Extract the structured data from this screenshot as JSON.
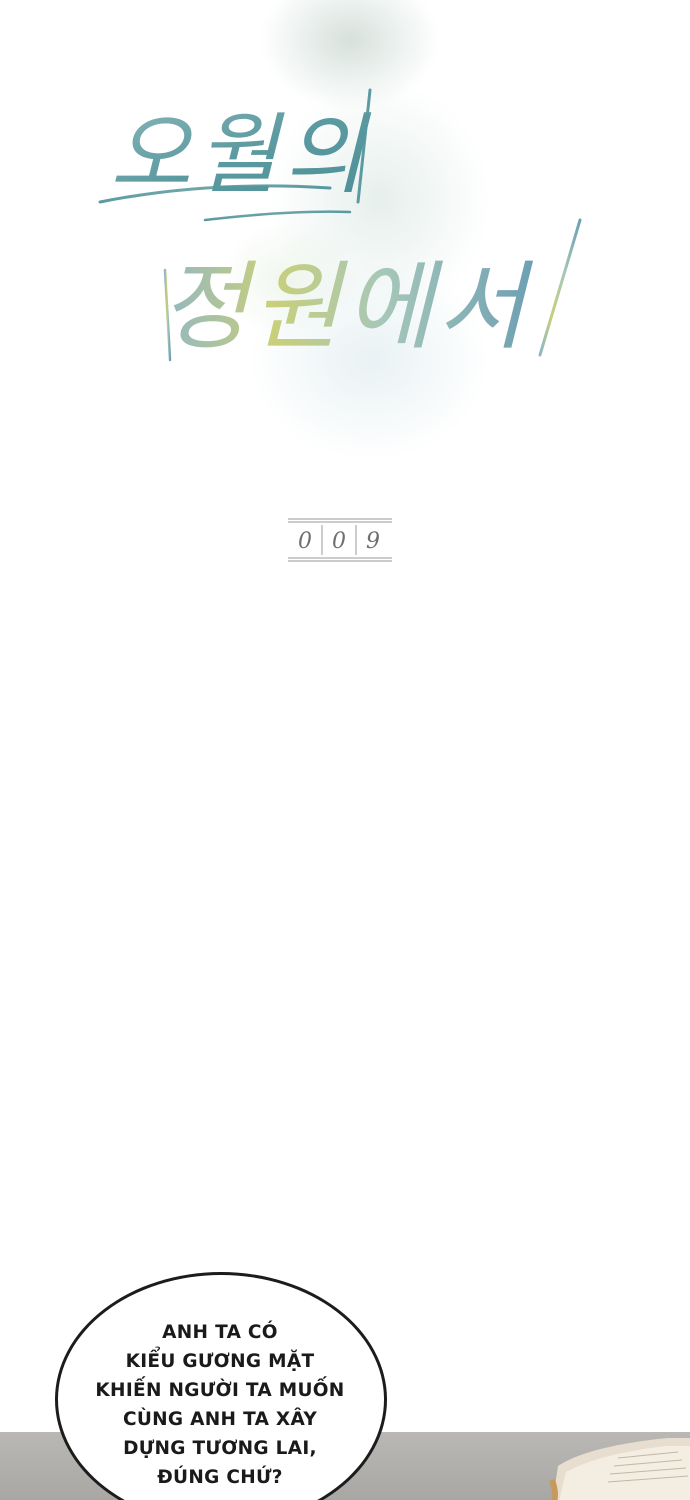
{
  "title": {
    "line1": "오월의",
    "line2": "정원에서"
  },
  "chapter": {
    "digits": [
      "0",
      "0",
      "9"
    ]
  },
  "speech_bubble": {
    "lines": [
      "ANH TA CÓ",
      "KIỂU GƯƠNG MẶT",
      "KHIẾN NGƯỜI TA MUỐN",
      "CÙNG ANH TA XÂY",
      "DỰNG TƯƠNG LAI,",
      "ĐÚNG CHỨ?"
    ]
  },
  "colors": {
    "title_teal": "#5a9aa0",
    "title_yellow": "#c9cf7a",
    "bubble_outline": "#1c1c1c",
    "chapter_gray": "#8c8c8c"
  }
}
